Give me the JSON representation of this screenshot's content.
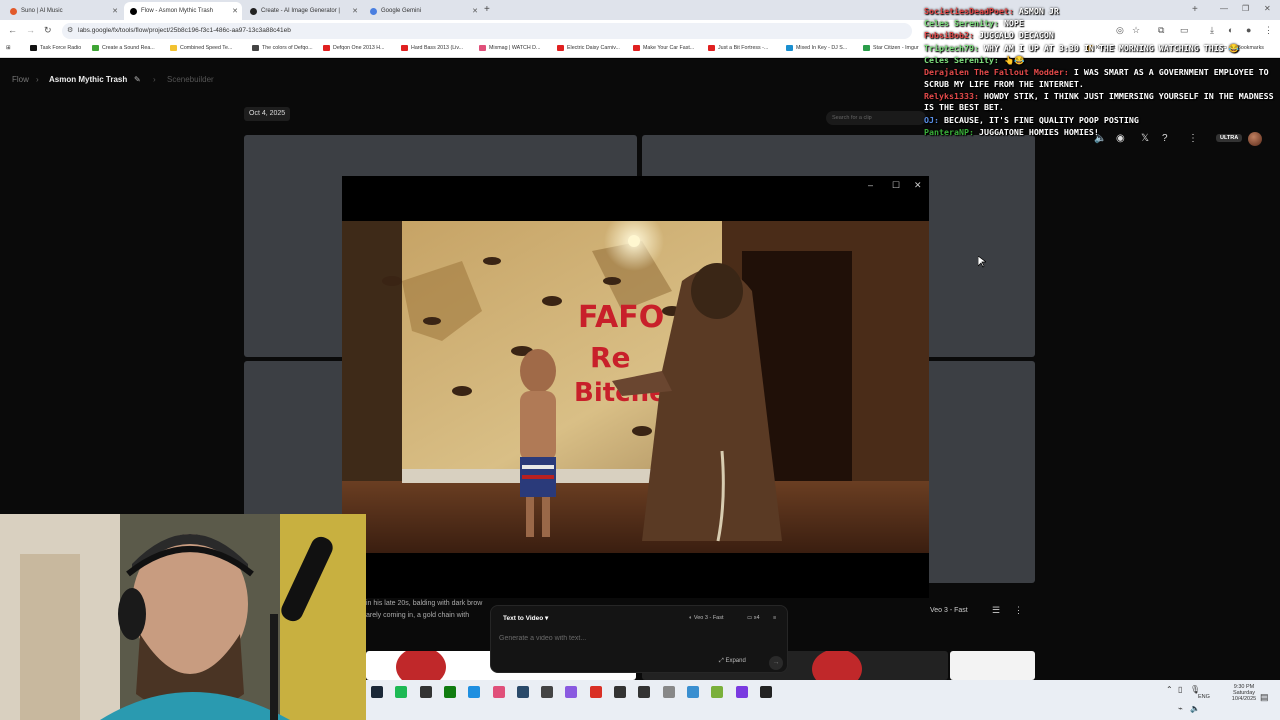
{
  "browser": {
    "tabs": [
      {
        "title": "Suno | AI Music",
        "color": "#e25a2b",
        "active": false
      },
      {
        "title": "Flow - Asmon Mythic Trash",
        "color": "#000000",
        "active": true
      },
      {
        "title": "Create - AI Image Generator |",
        "color": "#222222",
        "active": false
      },
      {
        "title": "Google Gemini",
        "color": "#4a7fe0",
        "active": false
      }
    ],
    "url": "labs.google/fx/tools/flow/project/25b8c196-f3c1-486c-aa97-13c3a88c41eb",
    "bookmarks": [
      {
        "label": "Task Force Radio",
        "color": "#111111"
      },
      {
        "label": "Create a Sound Rea...",
        "color": "#3fa535"
      },
      {
        "label": "Combined Speed Te...",
        "color": "#f2c230"
      },
      {
        "label": "The colors of Defqo...",
        "color": "#444444"
      },
      {
        "label": "Defqon One 2013 H...",
        "color": "#e02020"
      },
      {
        "label": "Hard Bass 2013 (Liv...",
        "color": "#e02020"
      },
      {
        "label": "Mixmag | WATCH D...",
        "color": "#e0507a"
      },
      {
        "label": "Electric Daisy Carniv...",
        "color": "#e02020"
      },
      {
        "label": "Make Your Car Fast...",
        "color": "#e02020"
      },
      {
        "label": "Just a Bit Fortress -...",
        "color": "#e02020"
      },
      {
        "label": "Mixed In Key - DJ S...",
        "color": "#1a8fd0"
      },
      {
        "label": "Star Citizen - Imgur",
        "color": "#2a9d4a"
      },
      {
        "label": "Kritz.net",
        "color": "#e0a020"
      }
    ],
    "all_bookmarks": "All Bookmarks"
  },
  "app": {
    "breadcrumb": {
      "root": "Flow",
      "project": "Asmon Mythic Trash",
      "section": "Scenebuilder"
    },
    "date_label": "Oct 4, 2025",
    "search_placeholder": "Search for a clip",
    "ultra_badge": "ULTRA",
    "prompt_preview": [
      "in his late 20s, balding with dark brow",
      "arely coming in, a gold chain with"
    ],
    "composer": {
      "mode": "Text to Video",
      "model": "Veo 3 - Fast",
      "count": "x4",
      "placeholder": "Generate a video with text...",
      "expand_label": "Expand"
    },
    "right_model_label": "Veo 3 - Fast"
  },
  "scene_text": [
    "FAFO",
    "Re",
    "Bitche"
  ],
  "chat": [
    {
      "user": "SocietiesDeadPoet:",
      "color": "#e44a4a",
      "message": "Asmon Jr"
    },
    {
      "user": "Celes Serenity:",
      "color": "#7fe07f",
      "message": "Nope"
    },
    {
      "user": "FubsiBob2:",
      "color": "#e44a4a",
      "message": "Juggalo Decagon"
    },
    {
      "user": "Triptech79:",
      "color": "#7fe07f",
      "message": "why am I up at 3:30 in the morning watching this 😂"
    },
    {
      "user": "Celes Serenity:",
      "color": "#7fe07f",
      "message": "👆😂"
    },
    {
      "user": "Derajalen The Fallout Modder:",
      "color": "#e44a4a",
      "message": "I was smart as a government employee to scrub my life from the internet."
    },
    {
      "user": "Relyks1333:",
      "color": "#e44a4a",
      "message": "Howdy stik, I think just immersing yourself in the madness is the best bet."
    },
    {
      "user": "OJ:",
      "color": "#5a8fe8",
      "message": "Because, it's fine quality poop posting"
    },
    {
      "user": "PanteraNP:",
      "color": "#3ab03a",
      "message": "Juggatone homies homies!"
    }
  ],
  "taskbar": {
    "icons": [
      {
        "name": "steam-icon",
        "color": "#1b2838"
      },
      {
        "name": "spotify-icon",
        "color": "#1db954"
      },
      {
        "name": "app-icon-3",
        "color": "#333333"
      },
      {
        "name": "xbox-icon",
        "color": "#107c10"
      },
      {
        "name": "edge-icon",
        "color": "#1f8fe0"
      },
      {
        "name": "app-icon-6",
        "color": "#e0507a"
      },
      {
        "name": "app-icon-7",
        "color": "#2a4a6a"
      },
      {
        "name": "app-icon-8",
        "color": "#444444"
      },
      {
        "name": "app-icon-9",
        "color": "#8a5ae0"
      },
      {
        "name": "chrome-icon",
        "color": "#d93025"
      },
      {
        "name": "app-icon-11",
        "color": "#333333"
      },
      {
        "name": "app-icon-12",
        "color": "#333333"
      },
      {
        "name": "app-icon-13",
        "color": "#888888"
      },
      {
        "name": "app-icon-14",
        "color": "#3a8fd0"
      },
      {
        "name": "app-icon-15",
        "color": "#7ab03a"
      },
      {
        "name": "app-icon-16",
        "color": "#7a3ae0"
      },
      {
        "name": "app-icon-17",
        "color": "#222222"
      }
    ],
    "lang": "ENG",
    "time": "9:30 PM",
    "day": "Saturday",
    "date": "10/4/2025"
  }
}
